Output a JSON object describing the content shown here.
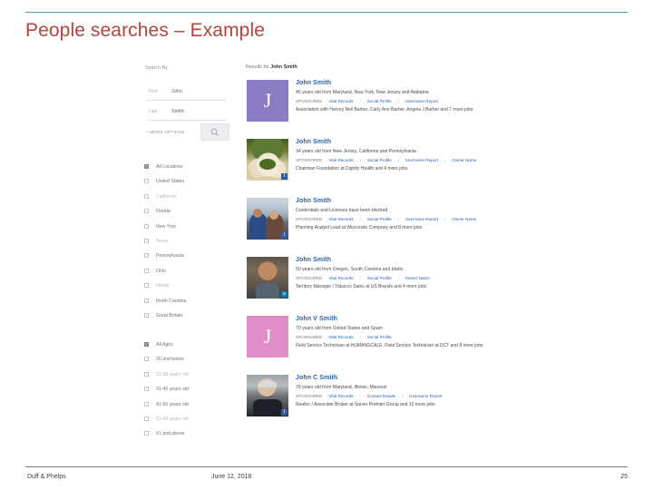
{
  "slide": {
    "title": "People searches – Example",
    "accent_rule_color": "#4a9fb0",
    "title_color": "#b6433a"
  },
  "screenshot": {
    "search_panel": {
      "heading": "Search By",
      "fields": [
        {
          "label": "First",
          "value": "John",
          "placeholder": "First"
        },
        {
          "label": "Last",
          "value": "Smith",
          "placeholder": "Last"
        }
      ],
      "more_options_label": "+ MORE OPTIONS",
      "search_button_icon": "search-icon"
    },
    "facets": {
      "locations": [
        {
          "label": "All Locations",
          "checked": true
        },
        {
          "label": "United States",
          "checked": false
        },
        {
          "label": "California",
          "checked": false
        },
        {
          "label": "Florida",
          "checked": false
        },
        {
          "label": "New York",
          "checked": false
        },
        {
          "label": "Texas",
          "checked": false
        },
        {
          "label": "Pennsylvania",
          "checked": false
        },
        {
          "label": "Ohio",
          "checked": false
        },
        {
          "label": "Illinois",
          "checked": false
        },
        {
          "label": "North Carolina",
          "checked": false
        },
        {
          "label": "Great Britain",
          "checked": false
        }
      ],
      "ages": [
        {
          "label": "All Ages",
          "checked": true
        },
        {
          "label": "20 and below",
          "checked": false
        },
        {
          "label": "21-30 years old",
          "checked": false
        },
        {
          "label": "31-40 years old",
          "checked": false
        },
        {
          "label": "41-50 years old",
          "checked": false
        },
        {
          "label": "51-60 years old",
          "checked": false
        },
        {
          "label": "61 and above",
          "checked": false
        }
      ]
    },
    "results_header_prefix": "Results for ",
    "results_header_query": "John Smith",
    "results": [
      {
        "name": "John Smith",
        "description": "45 years old from Maryland, New York, New Jersey and Alabama",
        "links": [
          "SPONSORED",
          "Vital Records",
          "Social Profile",
          "Username Report"
        ],
        "subtext": "Association with Harvey Neil Barber, Carly Ann Barber, Angela J Barber and 7 more jobs",
        "avatar_type": "initial",
        "avatar_initial": "J",
        "avatar_color": "#8d7cc4",
        "badge": ""
      },
      {
        "name": "John Smith",
        "description": "34 years old from New Jersey, California and Pennsylvania",
        "links": [
          "SPONSORED",
          "Vital Records",
          "Social Profile",
          "Username Report",
          "Owner Name"
        ],
        "subtext": "Chairman Foundation at Dignity Health and 4 more jobs",
        "avatar_type": "photo-food",
        "avatar_initial": "",
        "avatar_color": "",
        "badge": "facebook"
      },
      {
        "name": "John Smith",
        "description": "Credentials and Licenses have been blocked",
        "links": [
          "SPONSORED",
          "Vital Records",
          "Social Profile",
          "Username Report",
          "Owner Name"
        ],
        "subtext": "Planning Analyst Lead at Wisconsin Company and 8 more jobs",
        "avatar_type": "photo-couple",
        "avatar_initial": "",
        "avatar_color": "",
        "badge": "facebook"
      },
      {
        "name": "John Smith",
        "description": "50 years old from Oregon, South Carolina and Idaho",
        "links": [
          "SPONSORED",
          "Vital Records",
          "Social Profile",
          "Owner Name"
        ],
        "subtext": "Territory Manager / Tobacco Sales at US Brands and 4 more jobs",
        "avatar_type": "photo-man",
        "avatar_initial": "",
        "avatar_color": "",
        "badge": "linkedin"
      },
      {
        "name": "John V Smith",
        "description": "70 years old from United States and Spain",
        "links": [
          "SPONSORED",
          "Vital Records",
          "Social Profile"
        ],
        "subtext": "Field Service Technician at HUMANSCALE, Field Service Technician at DCT and 8 more jobs",
        "avatar_type": "initial",
        "avatar_initial": "J",
        "avatar_color": "#e08ec8",
        "badge": ""
      },
      {
        "name": "John C Smith",
        "description": "78 years old from Maryland, Illinois, Missouri",
        "links": [
          "SPONSORED",
          "Vital Records",
          "Contact Details",
          "Username Report"
        ],
        "subtext": "Realtor / Associate Broker at Sarver Premier Group and 12 more jobs",
        "avatar_type": "photo-elder",
        "avatar_initial": "",
        "avatar_color": "",
        "badge": "facebook"
      }
    ]
  },
  "footer": {
    "left": "Duff & Phelps",
    "center": "June 12, 2018",
    "page_number": "25"
  }
}
